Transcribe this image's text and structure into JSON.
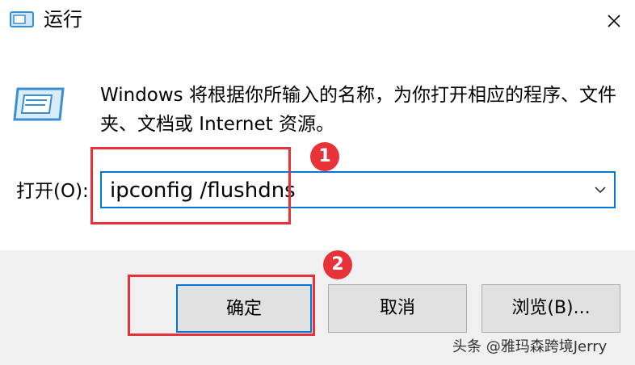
{
  "window": {
    "title": "运行",
    "close_glyph": "✕"
  },
  "description": "Windows 将根据你所输入的名称，为你打开相应的程序、文件夹、文档或 Internet 资源。",
  "open_field": {
    "label": "打开(O):",
    "value": "ipconfig /flushdns"
  },
  "buttons": {
    "ok": "确定",
    "cancel": "取消",
    "browse": "浏览(B)..."
  },
  "annotations": [
    {
      "number": "1",
      "color": "#e8323a"
    },
    {
      "number": "2",
      "color": "#e8323a"
    }
  ],
  "watermark": "头条 @雅玛森跨境Jerry",
  "colors": {
    "accent": "#0078d7",
    "annotation_red": "#e8323a",
    "footer_bg": "#f0f0f0",
    "button_bg": "#e1e1e1"
  }
}
